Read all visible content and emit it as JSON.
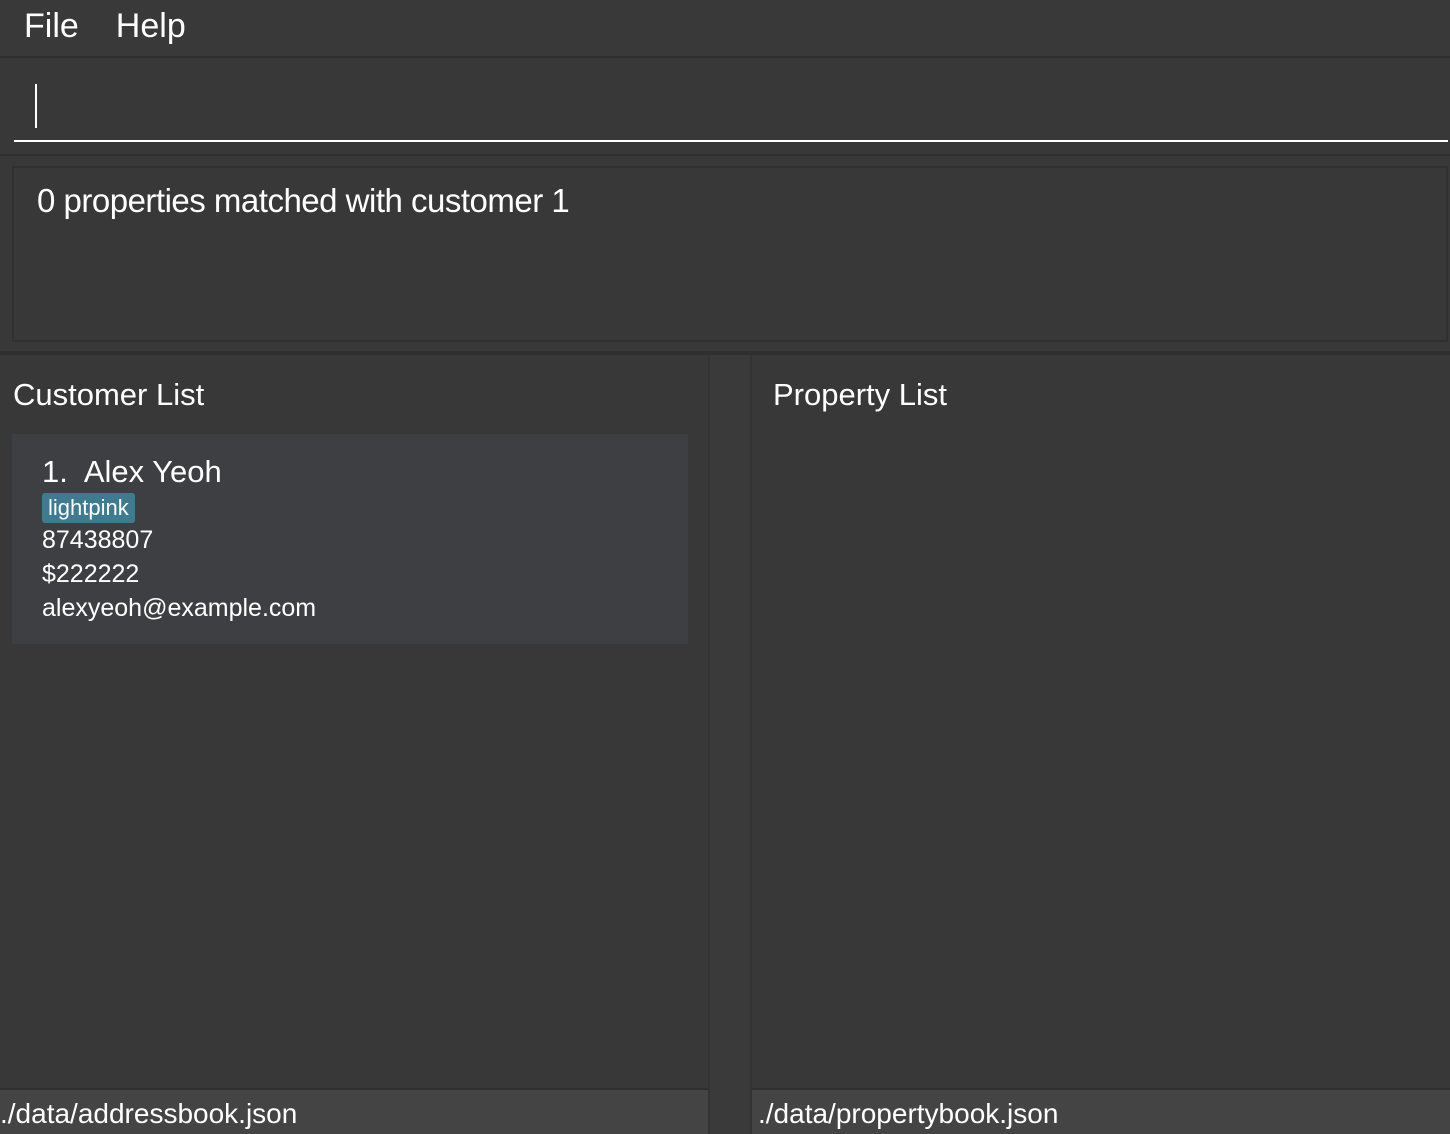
{
  "menu": {
    "file": "File",
    "help": "Help"
  },
  "command_box": {
    "value": ""
  },
  "result_display": {
    "text": "0 properties matched with customer 1"
  },
  "customer_list": {
    "title": "Customer List",
    "items": [
      {
        "index": "1.",
        "name": "Alex Yeoh",
        "tag": "lightpink",
        "phone": "87438807",
        "budget": "$222222",
        "email": "alexyeoh@example.com"
      }
    ]
  },
  "property_list": {
    "title": "Property List",
    "items": []
  },
  "status": {
    "left_path": "./data/addressbook.json",
    "right_path": "./data/propertybook.json"
  },
  "colors": {
    "background": "#383838",
    "card": "#3d3f42",
    "tag": "#3e7b91",
    "statusbar": "#444444"
  }
}
